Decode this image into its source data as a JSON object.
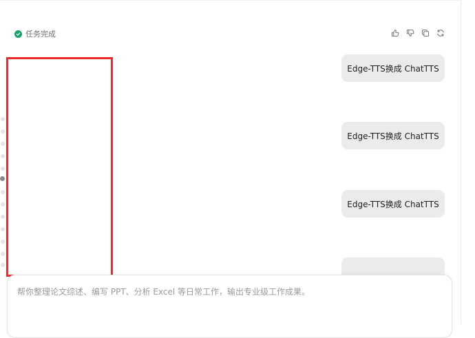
{
  "status": {
    "text": "任务完成",
    "icon": "check-circle-icon",
    "color": "#16a36b"
  },
  "message_actions": [
    {
      "name": "thumbs-up-icon"
    },
    {
      "name": "thumbs-down-icon"
    },
    {
      "name": "copy-icon"
    },
    {
      "name": "regenerate-icon"
    }
  ],
  "messages": [
    {
      "text": "Edge-TTS换成 ChatTTS"
    },
    {
      "text": "Edge-TTS换成 ChatTTS"
    },
    {
      "text": "Edge-TTS换成 ChatTTS"
    },
    {
      "text": ""
    }
  ],
  "composer": {
    "placeholder": "帮你整理论文综述、编写 PPT、分析 Excel 等日常工作，输出专业级工作成果。"
  },
  "highlight": {
    "color": "#f1282c"
  }
}
